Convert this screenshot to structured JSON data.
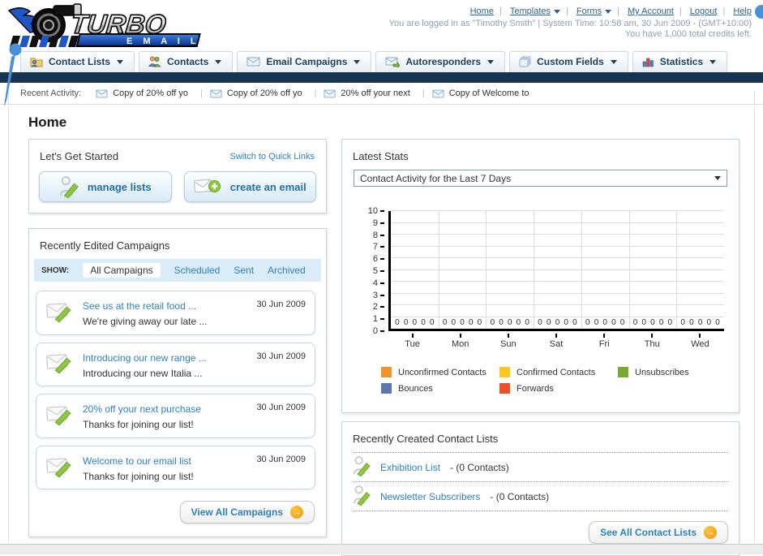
{
  "header": {
    "logo": {
      "line1": "TURBO",
      "line2": "E M A I L"
    },
    "nav_links": [
      {
        "label": "Home",
        "dropdown": false
      },
      {
        "label": "Templates",
        "dropdown": true
      },
      {
        "label": "Forms",
        "dropdown": true
      },
      {
        "label": "My Account",
        "dropdown": false
      },
      {
        "label": "Logout",
        "dropdown": false
      },
      {
        "label": "Help",
        "dropdown": false
      }
    ],
    "login_line": "You are logged in as \"Timothy Smith\" | System Time: 10:58 am, 30 Jun 2009 - (GMT+10:00)",
    "credits_line": "You have 1,000 total credits left."
  },
  "tabs": [
    {
      "label": "Contact Lists",
      "icon": "contact-lists-folder-icon"
    },
    {
      "label": "Contacts",
      "icon": "contacts-people-icon"
    },
    {
      "label": "Email Campaigns",
      "icon": "envelope-icon"
    },
    {
      "label": "Autoresponders",
      "icon": "envelope-arrow-icon"
    },
    {
      "label": "Custom Fields",
      "icon": "pages-icon"
    },
    {
      "label": "Statistics",
      "icon": "bar-chart-icon"
    }
  ],
  "recent_activity": {
    "label": "Recent Activity:",
    "items": [
      "Copy of 20% off yo",
      "Copy of 20% off yo",
      "20% off your next",
      "Copy of Welcome to"
    ]
  },
  "page_title": "Home",
  "get_started": {
    "title": "Let's Get Started",
    "switch_link": "Switch to Quick Links",
    "buttons": [
      {
        "label": "manage lists",
        "icon": "person-pencil-icon"
      },
      {
        "label": "create an email",
        "icon": "envelope-plus-icon"
      }
    ]
  },
  "campaigns": {
    "title": "Recently Edited Campaigns",
    "show_label": "SHOW:",
    "filters": [
      "All Campaigns",
      "Scheduled",
      "Sent",
      "Archived"
    ],
    "active_filter": "All Campaigns",
    "items": [
      {
        "title": "See us at the retail food ...",
        "subtitle": "We're giving away our late ...",
        "date": "30 Jun 2009"
      },
      {
        "title": "Introducing our new range ...",
        "subtitle": "Introducing our new Italia ...",
        "date": "30 Jun 2009"
      },
      {
        "title": "20% off your next purchase",
        "subtitle": "Thanks for joining our list!",
        "date": "30 Jun 2009"
      },
      {
        "title": "Welcome to our email list",
        "subtitle": "Thanks for joining our list!",
        "date": "30 Jun 2009"
      }
    ],
    "view_all": "View All Campaigns"
  },
  "stats": {
    "title": "Latest Stats",
    "dropdown_value": "Contact Activity for the Last 7 Days"
  },
  "chart_data": {
    "type": "bar",
    "title": "Contact Activity for the Last 7 Days",
    "categories": [
      "Tue",
      "Mon",
      "Sun",
      "Sat",
      "Fri",
      "Thu",
      "Wed"
    ],
    "series": [
      {
        "name": "Unconfirmed Contacts",
        "color": "#F0932B",
        "values": [
          0,
          0,
          0,
          0,
          0,
          0,
          0
        ]
      },
      {
        "name": "Confirmed Contacts",
        "color": "#FFC61E",
        "values": [
          0,
          0,
          0,
          0,
          0,
          0,
          0
        ]
      },
      {
        "name": "Unsubscribes",
        "color": "#77A82F",
        "values": [
          0,
          0,
          0,
          0,
          0,
          0,
          0
        ]
      },
      {
        "name": "Bounces",
        "color": "#5F77AE",
        "values": [
          0,
          0,
          0,
          0,
          0,
          0,
          0
        ]
      },
      {
        "name": "Forwards",
        "color": "#E8512E",
        "values": [
          0,
          0,
          0,
          0,
          0,
          0,
          0
        ]
      }
    ],
    "ylim": [
      0,
      10
    ],
    "yticks": [
      0,
      1,
      2,
      3,
      4,
      5,
      6,
      7,
      8,
      9,
      10
    ],
    "grid": true,
    "value_labels_shown": true,
    "legend_position": "bottom"
  },
  "contact_lists": {
    "title": "Recently Created Contact Lists",
    "items": [
      {
        "name": "Exhibition List",
        "suffix": "- (0 Contacts)"
      },
      {
        "name": "Newsletter Subscribers",
        "suffix": "- (0 Contacts)"
      }
    ],
    "see_all": "See All Contact Lists"
  },
  "icons": {
    "arrow_circle": "→",
    "dropdown_arrow": "▼"
  },
  "colors": {
    "nav_bar": "#173451",
    "link_blue": "#2d7fc1",
    "filter_bar_bg": "#d9ecf8",
    "logo_blue": "#1e56c8"
  }
}
